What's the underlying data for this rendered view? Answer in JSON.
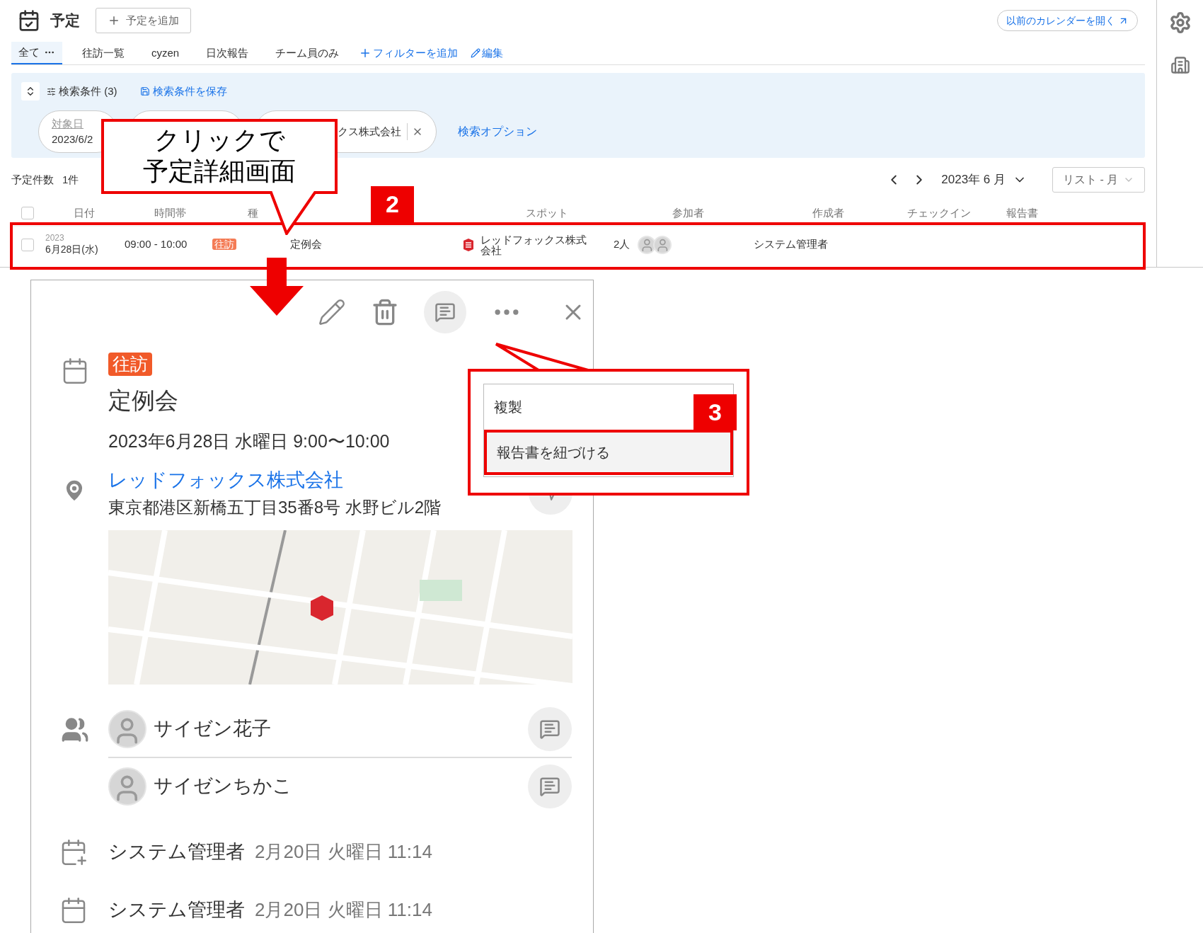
{
  "header": {
    "title": "予定",
    "add_button": "予定を追加",
    "old_calendar_link": "以前のカレンダーを開く"
  },
  "tabs": [
    {
      "label": "全て",
      "selected": true
    },
    {
      "label": "往訪一覧",
      "selected": false
    },
    {
      "label": "cyzen",
      "selected": false
    },
    {
      "label": "日次報告",
      "selected": false
    },
    {
      "label": "チーム員のみ",
      "selected": false
    }
  ],
  "filter_links": [
    {
      "kind": "add",
      "label": "フィルターを追加"
    },
    {
      "kind": "edit",
      "label": "編集"
    }
  ],
  "search": {
    "title": "検索条件 (3)",
    "save_link": "検索条件を保存",
    "chips": [
      {
        "kind": "field",
        "label": "対象日",
        "value": "2023/6/2",
        "removable": false
      },
      {
        "kind": "blank"
      },
      {
        "kind": "field",
        "value": "クス株式会社",
        "removable": true
      }
    ],
    "options_link": "検索オプション"
  },
  "count": {
    "label": "予定件数",
    "value": "1件"
  },
  "pager": {
    "month": "2023年 6 月",
    "view": "リスト - 月"
  },
  "table": {
    "all_checked": false,
    "columns": [
      "日付",
      "時間帯",
      "種",
      "スポット",
      "参加者",
      "作成者",
      "チェックイン",
      "報告書"
    ],
    "rows": [
      {
        "checked": false,
        "year": "2023",
        "date": "6月28日(水)",
        "time": "09:00 - 10:00",
        "type": "往訪",
        "title": "定例会",
        "spot": "レッドフォックス株式会社",
        "participants": "2人",
        "creator": "システム管理者"
      }
    ]
  },
  "detail": {
    "type": "往訪",
    "title": "定例会",
    "datetime": "2023年6月28日 水曜日 9:00〜10:00",
    "spot": "レッドフォックス株式会社",
    "address": "東京都港区新橋五丁目35番8号 水野ビル2階",
    "participants": [
      {
        "name": "サイゼン花子"
      },
      {
        "name": "サイゼンちかこ"
      }
    ],
    "history": [
      {
        "kind": "created",
        "user": "システム管理者",
        "time": "2月20日 火曜日 11:14"
      },
      {
        "kind": "edited",
        "user": "システム管理者",
        "time": "2月20日 火曜日 11:14"
      }
    ]
  },
  "menu": {
    "items": [
      {
        "label": "複製",
        "highlighted": false
      },
      {
        "label": "報告書を紐づける",
        "highlighted": true
      }
    ]
  },
  "annotations": {
    "callout": [
      "クリックで",
      "予定詳細画面"
    ],
    "steps": [
      "2",
      "3"
    ]
  }
}
